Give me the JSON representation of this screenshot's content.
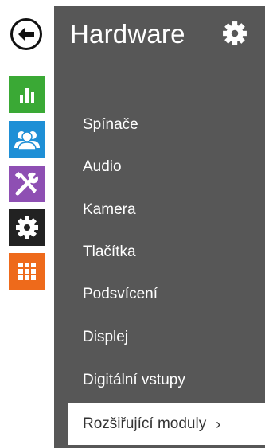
{
  "rail": {
    "back": {
      "icon": "arrow-left-icon"
    },
    "tiles": [
      {
        "icon": "bar-chart-icon",
        "color": "#3aa935"
      },
      {
        "icon": "users-icon",
        "color": "#1e8fd6"
      },
      {
        "icon": "tools-icon",
        "color": "#8e4fb3"
      },
      {
        "icon": "gear-icon",
        "color": "#222222"
      },
      {
        "icon": "grid-icon",
        "color": "#ee6a1b"
      }
    ]
  },
  "panel": {
    "title": "Hardware",
    "settings_icon": "gear-icon",
    "background": "#575757"
  },
  "menu": {
    "items": [
      {
        "label": "Spínače"
      },
      {
        "label": "Audio"
      },
      {
        "label": "Kamera"
      },
      {
        "label": "Tlačítka"
      },
      {
        "label": "Podsvícení"
      },
      {
        "label": "Displej"
      },
      {
        "label": "Digitální vstupy"
      }
    ],
    "active": {
      "label": "Rozšiřující moduly",
      "chevron": "›"
    }
  }
}
